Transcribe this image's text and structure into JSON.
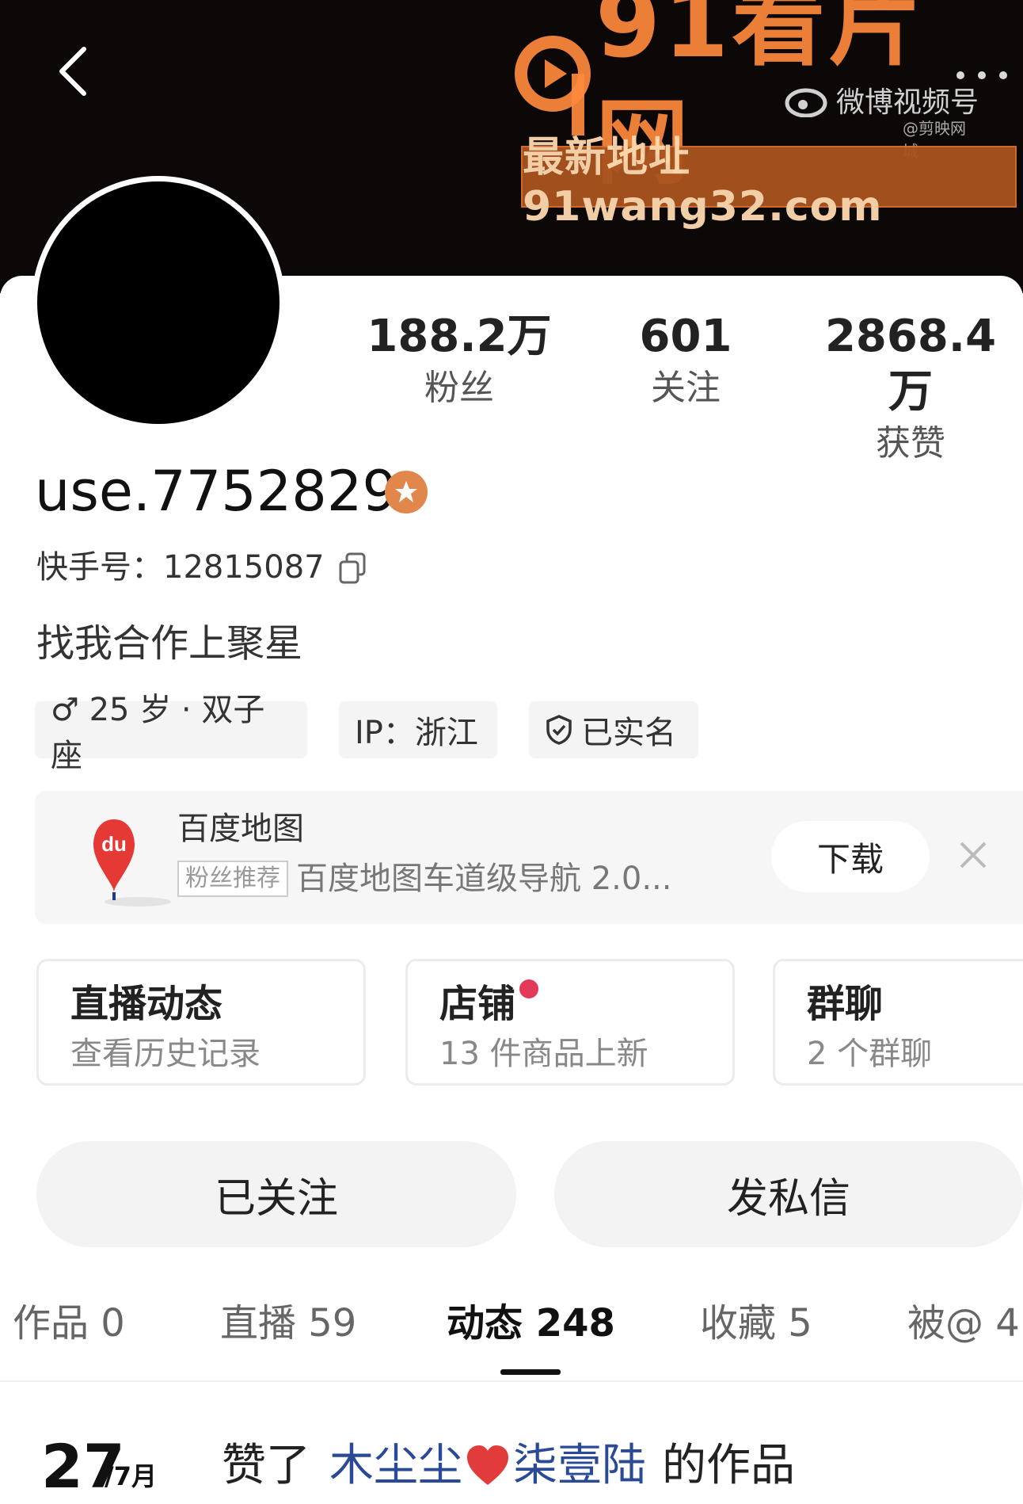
{
  "header": {
    "back_icon": "chevron-left-icon",
    "more_icon": "more-dots-icon",
    "watermark": {
      "logo_text": "91看片网",
      "url_text": "最新地址91wang32.com",
      "weibo_text": "微博视频号",
      "weibo_handle": "@剪映网城"
    }
  },
  "profile": {
    "stats": [
      {
        "value": "188.2万",
        "label": "粉丝"
      },
      {
        "value": "601",
        "label": "关注"
      },
      {
        "value": "2868.4万",
        "label": "获赞"
      }
    ],
    "username": "use.7752829",
    "kuaishou_id": "快手号：12815087",
    "bio": "找我合作上聚星",
    "tags": [
      {
        "text": "♂ 25 岁 · 双子座"
      },
      {
        "text": "IP：浙江"
      },
      {
        "text": "已实名"
      }
    ]
  },
  "ad": {
    "app_name": "百度地图",
    "logo_text": "du",
    "badge": "粉丝推荐",
    "description": "百度地图车道级导航 2.0...",
    "download_label": "下载"
  },
  "features": [
    {
      "title": "直播动态",
      "subtitle": "查看历史记录"
    },
    {
      "title": "店铺",
      "subtitle": "13 件商品上新"
    },
    {
      "title": "群聊",
      "subtitle": "2 个群聊"
    }
  ],
  "actions": {
    "followed_label": "已关注",
    "message_label": "发私信"
  },
  "tabs": [
    {
      "label": "作品 0"
    },
    {
      "label": "直播 59"
    },
    {
      "label": "动态 248"
    },
    {
      "label": "收藏 5"
    },
    {
      "label": "被@ 4"
    }
  ],
  "active_tab": 2,
  "feed": {
    "day": "27",
    "month": "/7月",
    "action": "赞了",
    "user1": "木尘尘",
    "user2": "柒壹陆",
    "suffix": "的作品"
  },
  "colors": {
    "header_bg": "#0d0808",
    "accent_orange": "#e2874c",
    "link_blue": "#2a4a96",
    "red_dot": "#e23b5a"
  }
}
